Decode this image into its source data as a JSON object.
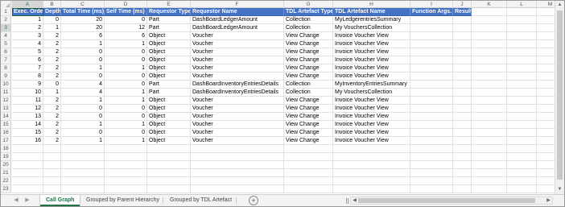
{
  "sheet": {
    "columns": [
      "A",
      "B",
      "C",
      "D",
      "E",
      "F",
      "G",
      "H",
      "I",
      "J",
      "K",
      "L",
      "M"
    ],
    "selected_column": "A",
    "selected_row": "3",
    "row_numbers": [
      "1",
      "2",
      "3",
      "4",
      "5",
      "6",
      "7",
      "8",
      "9",
      "10",
      "11",
      "12",
      "13",
      "14",
      "15",
      "16",
      "17",
      "18",
      "19",
      "20",
      "21",
      "22",
      "23"
    ],
    "header": [
      "Exec. Order",
      "Depth",
      "Total Time (ms)",
      "Self Time (ms)",
      "Requestor Type",
      "Requestor Name",
      "TDL Artefact Type",
      "TDL Artefact Name",
      "Function Args.",
      "Result",
      "",
      "",
      ""
    ],
    "rows": [
      [
        "1",
        "0",
        "20",
        "0",
        "Part",
        "DashBoardLedgerAmount",
        "Collection",
        "MyLedgerentriesSummary",
        "",
        "",
        "",
        "",
        ""
      ],
      [
        "2",
        "1",
        "20",
        "12",
        "Part",
        "DashBoardLedgerAmount",
        "Collection",
        "My VouchersCollection",
        "",
        "",
        "",
        "",
        ""
      ],
      [
        "3",
        "2",
        "6",
        "6",
        "Object",
        "Voucher",
        "View Change",
        "Invoice Voucher View",
        "",
        "",
        "",
        "",
        ""
      ],
      [
        "4",
        "2",
        "1",
        "1",
        "Object",
        "Voucher",
        "View Change",
        "Invoice Voucher View",
        "",
        "",
        "",
        "",
        ""
      ],
      [
        "5",
        "2",
        "0",
        "0",
        "Object",
        "Voucher",
        "View Change",
        "Invoice Voucher View",
        "",
        "",
        "",
        "",
        ""
      ],
      [
        "6",
        "2",
        "0",
        "0",
        "Object",
        "Voucher",
        "View Change",
        "Invoice Voucher View",
        "",
        "",
        "",
        "",
        ""
      ],
      [
        "7",
        "2",
        "1",
        "1",
        "Object",
        "Voucher",
        "View Change",
        "Invoice Voucher View",
        "",
        "",
        "",
        "",
        ""
      ],
      [
        "8",
        "2",
        "0",
        "0",
        "Object",
        "Voucher",
        "View Change",
        "Invoice Voucher View",
        "",
        "",
        "",
        "",
        ""
      ],
      [
        "9",
        "0",
        "4",
        "0",
        "Part",
        "DashBoardInventoryEntriesDetails",
        "Collection",
        "MyInventoryEntriesSummary",
        "",
        "",
        "",
        "",
        ""
      ],
      [
        "10",
        "1",
        "4",
        "1",
        "Part",
        "DashBoardInventoryEntriesDetails",
        "Collection",
        "My VouchersCollection",
        "",
        "",
        "",
        "",
        ""
      ],
      [
        "11",
        "2",
        "1",
        "1",
        "Object",
        "Voucher",
        "View Change",
        "Invoice Voucher View",
        "",
        "",
        "",
        "",
        ""
      ],
      [
        "12",
        "2",
        "0",
        "0",
        "Object",
        "Voucher",
        "View Change",
        "Invoice Voucher View",
        "",
        "",
        "",
        "",
        ""
      ],
      [
        "13",
        "2",
        "0",
        "0",
        "Object",
        "Voucher",
        "View Change",
        "Invoice Voucher View",
        "",
        "",
        "",
        "",
        ""
      ],
      [
        "14",
        "2",
        "1",
        "1",
        "Object",
        "Voucher",
        "View Change",
        "Invoice Voucher View",
        "",
        "",
        "",
        "",
        ""
      ],
      [
        "15",
        "2",
        "0",
        "0",
        "Object",
        "Voucher",
        "View Change",
        "Invoice Voucher View",
        "",
        "",
        "",
        "",
        ""
      ],
      [
        "16",
        "2",
        "1",
        "1",
        "Object",
        "Voucher",
        "View Change",
        "Invoice Voucher View",
        "",
        "",
        "",
        "",
        ""
      ]
    ]
  },
  "tabs": {
    "items": [
      "Call Graph",
      "Grouped by Parent Hierarchy",
      "Grouped by TDL Artefact"
    ],
    "active": "Call Graph",
    "add_label": "+",
    "nav_prev": "◀",
    "nav_next": "▶"
  },
  "icons": {
    "add_sheet": "plus-circle-icon",
    "scroll_up": "caret-up-icon",
    "scroll_down": "caret-down-icon",
    "scroll_left": "caret-left-icon",
    "scroll_right": "caret-right-icon"
  },
  "colors": {
    "header_fill": "#4472c4",
    "header_text": "#ffffff",
    "active_tab": "#217346",
    "grid": "#e1e1e1"
  }
}
